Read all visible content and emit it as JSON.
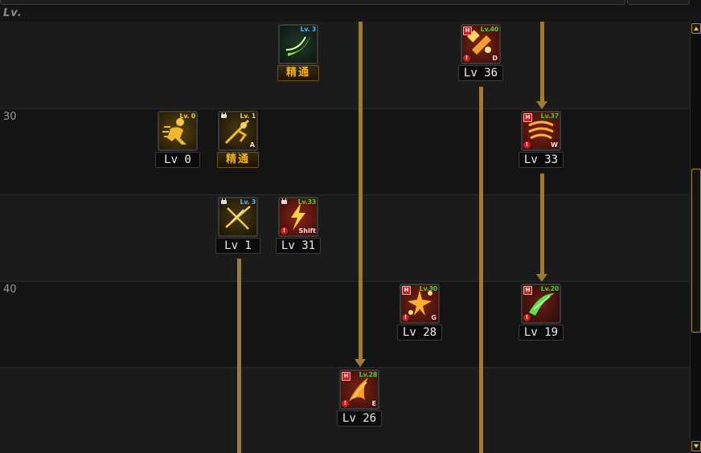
{
  "header": {
    "lv_label": "Lv."
  },
  "rows": [
    {
      "label": ""
    },
    {
      "label": "30"
    },
    {
      "label": ""
    },
    {
      "label": "40"
    },
    {
      "label": ""
    }
  ],
  "colors": {
    "connector": "#9c7a3c",
    "tag_green": "#3fd43f",
    "tag_blue": "#4ab8ff",
    "mastery_text": "#f0b020",
    "hotkey_badge": "#c91e1e"
  },
  "skills": [
    {
      "id": "skill-green-crescent",
      "tag": "Lv. 3",
      "tag_color": "blue",
      "locked": false,
      "hb": false,
      "warn": false,
      "hotkey": "",
      "bottom": "精通",
      "bottom_type": "mastery",
      "icon": "green-crescent-icon"
    },
    {
      "id": "skill-lv36",
      "tag": "Lv.40",
      "tag_color": "green",
      "hb": true,
      "hb_label": "H",
      "locked": false,
      "warn": true,
      "hotkey": "D",
      "bottom": "Lv 36",
      "bottom_type": "level",
      "icon": "hammer-strike-icon"
    },
    {
      "id": "skill-lv0",
      "tag": "Lv. 0",
      "tag_color": "yellow",
      "locked": false,
      "hb": false,
      "warn": false,
      "hotkey": "",
      "bottom": "Lv 0",
      "bottom_type": "level",
      "icon": "sprint-figure-icon"
    },
    {
      "id": "skill-locked-a",
      "tag": "Lv. 1",
      "tag_color": "yellow",
      "locked": true,
      "hb": false,
      "warn": false,
      "hotkey": "A",
      "bottom": "精通",
      "bottom_type": "mastery",
      "icon": "dash-figure-icon"
    },
    {
      "id": "skill-lv33",
      "tag": "Lv.37",
      "tag_color": "green",
      "hb": true,
      "hb_label": "H",
      "locked": false,
      "warn": true,
      "hotkey": "W",
      "bottom": "Lv 33",
      "bottom_type": "level",
      "icon": "whirlwind-icon"
    },
    {
      "id": "skill-lv1",
      "tag": "Lv. 3",
      "tag_color": "blue",
      "locked": true,
      "hb": false,
      "warn": false,
      "hotkey": "",
      "bottom": "Lv 1",
      "bottom_type": "level",
      "icon": "cross-slash-icon"
    },
    {
      "id": "skill-lv31",
      "tag": "Lv.33",
      "tag_color": "green",
      "locked": true,
      "hb": false,
      "warn": true,
      "hotkey": "Shift",
      "bottom": "Lv 31",
      "bottom_type": "level",
      "icon": "lightning-icon"
    },
    {
      "id": "skill-lv28",
      "tag": "Lv.30",
      "tag_color": "green",
      "hb": true,
      "hb_label": "H",
      "locked": false,
      "warn": true,
      "hotkey": "G",
      "bottom": "Lv 28",
      "bottom_type": "level",
      "icon": "burst-stars-icon"
    },
    {
      "id": "skill-lv19",
      "tag": "Lv.20",
      "tag_color": "green",
      "hb": true,
      "hb_label": "H",
      "locked": false,
      "warn": true,
      "hotkey": "",
      "bottom": "Lv 19",
      "bottom_type": "level",
      "icon": "green-slash-icon"
    },
    {
      "id": "skill-lv26",
      "tag": "Lv.28",
      "tag_color": "green",
      "hb": true,
      "hb_label": "H",
      "locked": false,
      "warn": true,
      "hotkey": "E",
      "bottom": "Lv 26",
      "bottom_type": "level",
      "icon": "fire-claw-icon"
    }
  ]
}
